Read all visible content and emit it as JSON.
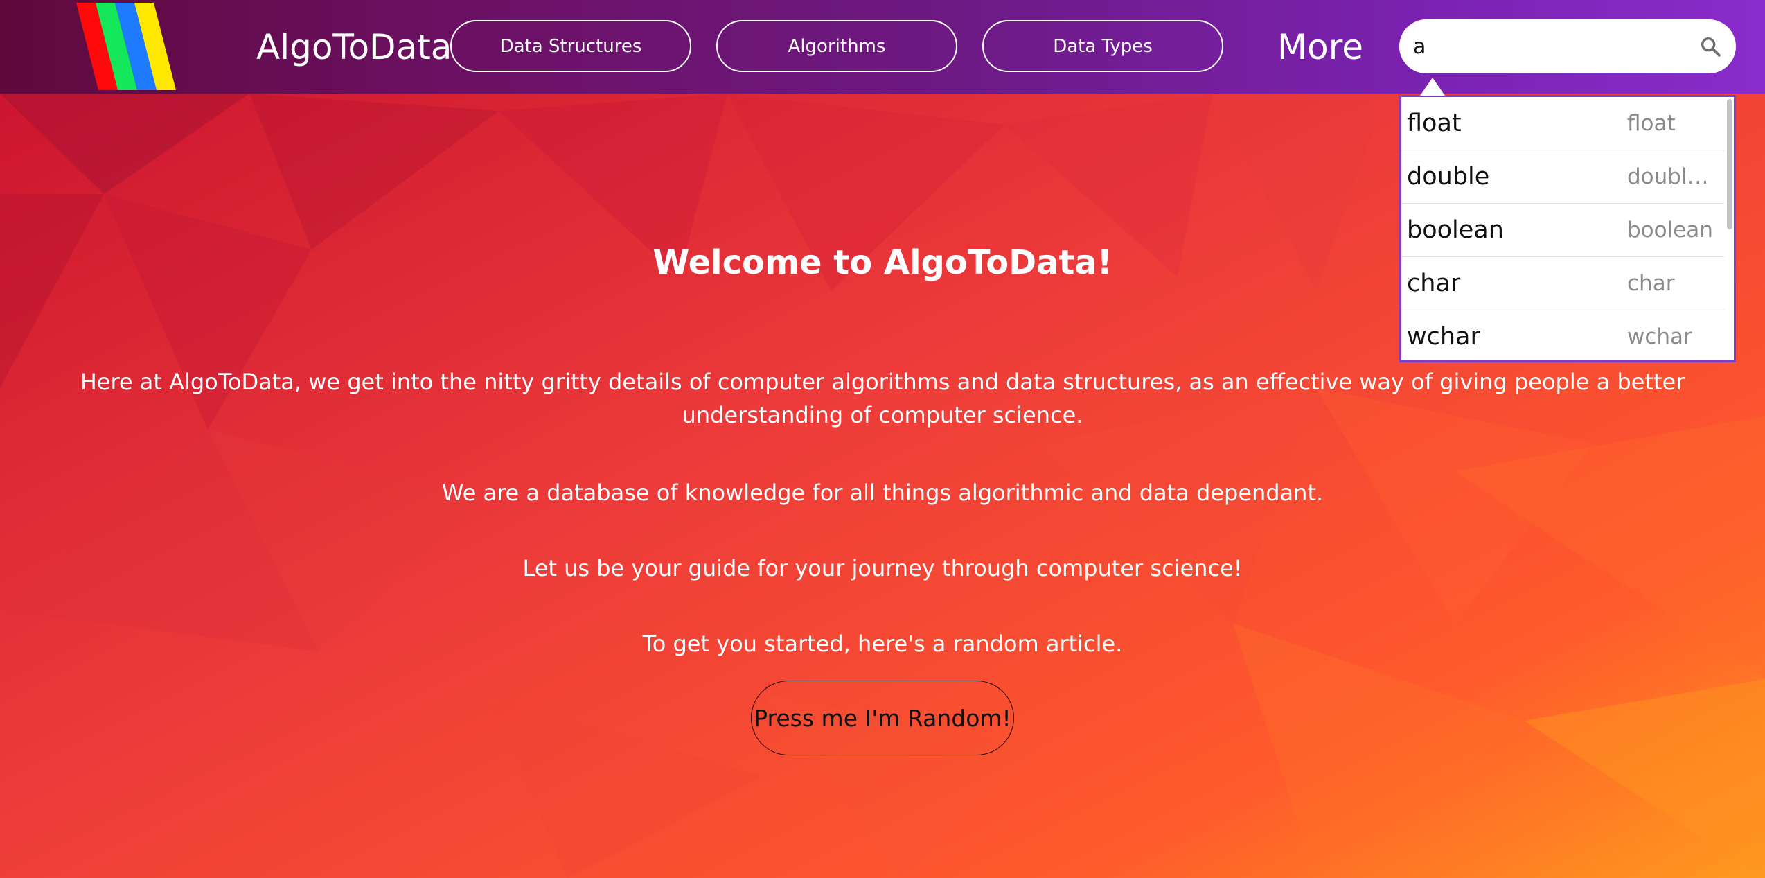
{
  "header": {
    "brand": "AlgoToData",
    "nav": [
      "Data Structures",
      "Algorithms",
      "Data Types"
    ],
    "more_label": "More",
    "search_value": "a",
    "search_icon": "search-icon",
    "logo_colors": [
      "#ff0a0a",
      "#14e85a",
      "#1e7bff",
      "#ffe800"
    ]
  },
  "suggestions": [
    {
      "label": "float",
      "hint": "float"
    },
    {
      "label": "double",
      "hint": "double precision"
    },
    {
      "label": "boolean",
      "hint": "boolean"
    },
    {
      "label": "char",
      "hint": "char"
    },
    {
      "label": "wchar",
      "hint": "wchar"
    }
  ],
  "main": {
    "title": "Welcome to AlgoToData!",
    "intro": "Here at AlgoToData, we get into the nitty gritty details of computer algorithms and data structures, as an effective way of giving people a better understanding of computer science.",
    "p2": "We are a database of knowledge for all things algorithmic and data dependant.",
    "p3": "Let us be your guide for your journey through computer science!",
    "p4": "To get you started, here's a random article.",
    "random_button": "Press me I'm Random!"
  },
  "colors": {
    "header_start": "#5e0a3c",
    "header_end": "#8a2ccc",
    "background_red": "#e8323b",
    "background_orange": "#ff8c1f",
    "dropdown_border": "#7b3fd0"
  }
}
